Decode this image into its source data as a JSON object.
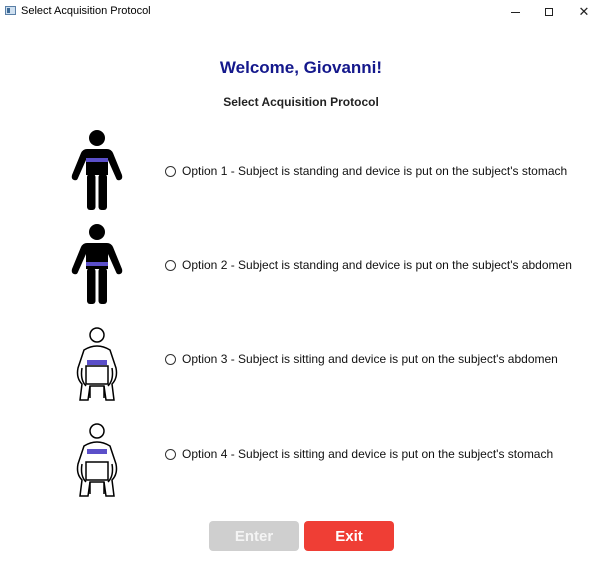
{
  "window": {
    "title": "Select Acquisition Protocol",
    "controls": {
      "minimize": "–",
      "maximize": "☐",
      "close": "✕"
    }
  },
  "header": {
    "welcome": "Welcome, Giovanni!",
    "subtitle": "Select Acquisition Protocol"
  },
  "options": [
    {
      "label": "Option 1 - Subject is standing and device is put on the subject's stomach",
      "icon": "standing-person-stomach-icon",
      "selected": false
    },
    {
      "label": "Option 2 - Subject is standing and device is put on the subject's abdomen",
      "icon": "standing-person-abdomen-icon",
      "selected": false
    },
    {
      "label": "Option 3 - Subject is sitting and device is put on the subject's abdomen",
      "icon": "sitting-person-abdomen-icon",
      "selected": false
    },
    {
      "label": "Option 4 - Subject is sitting and device is put on the subject's stomach",
      "icon": "sitting-person-stomach-icon",
      "selected": false
    }
  ],
  "buttons": {
    "enter": "Enter",
    "exit": "Exit"
  },
  "colors": {
    "welcome": "#14188c",
    "device_band": "#5b4fc9",
    "enter_disabled": "#cfcfcf",
    "exit": "#ef3e35"
  }
}
